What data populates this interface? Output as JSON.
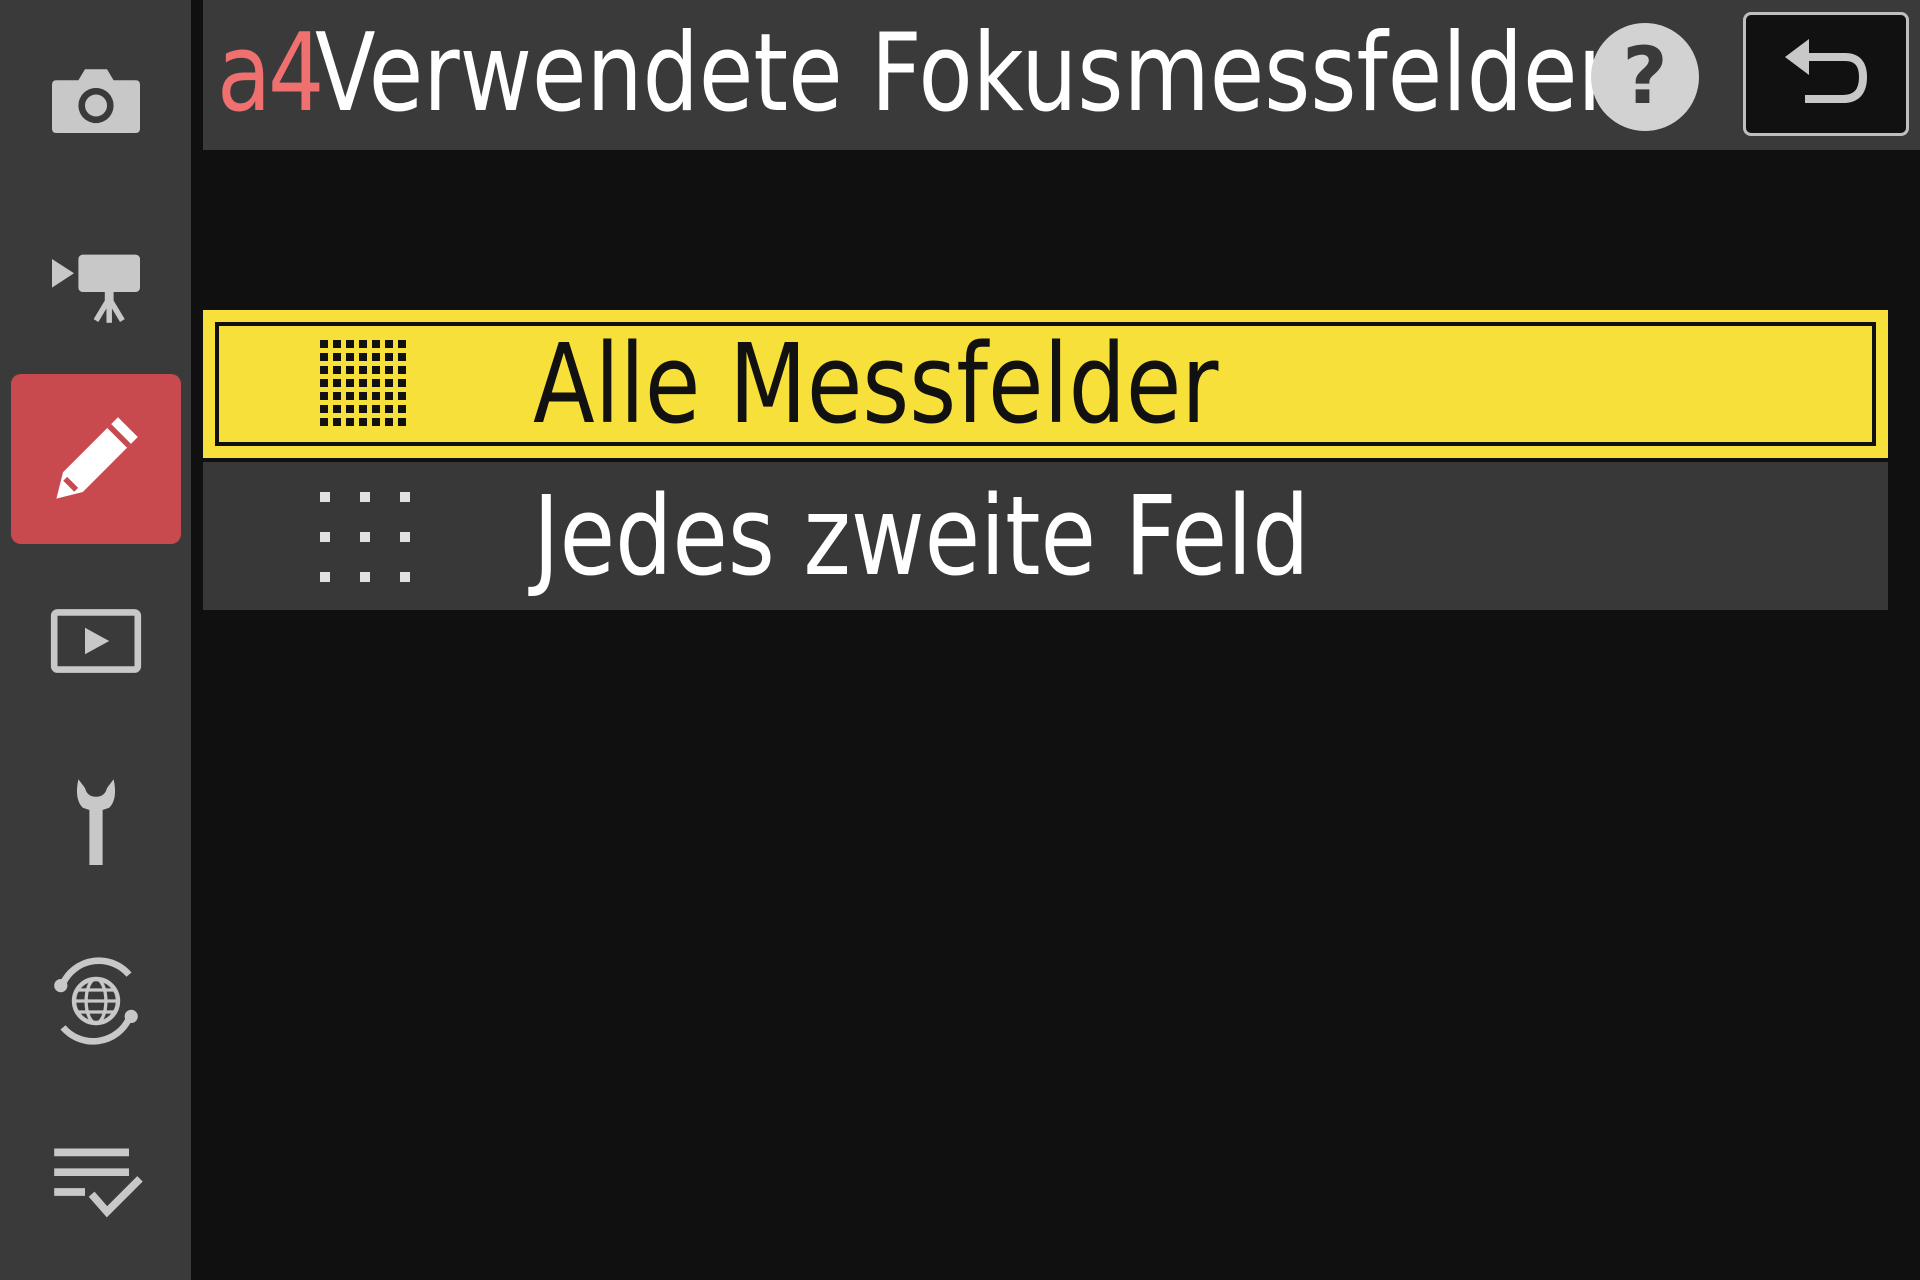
{
  "sidebar": {
    "tabs": [
      {
        "icon": "camera-icon",
        "name": "photo-shooting-menu",
        "active": false
      },
      {
        "icon": "movie-camera-icon",
        "name": "movie-recording-menu",
        "active": false
      },
      {
        "icon": "pencil-icon",
        "name": "custom-settings-menu",
        "active": true
      },
      {
        "icon": "playback-icon",
        "name": "playback-menu",
        "active": false
      },
      {
        "icon": "wrench-icon",
        "name": "setup-menu",
        "active": false
      },
      {
        "icon": "network-globe-icon",
        "name": "network-menu",
        "active": false
      },
      {
        "icon": "checklist-icon",
        "name": "my-menu",
        "active": false
      }
    ],
    "active_color": "#c84a4e"
  },
  "header": {
    "code": "a4",
    "title": "Verwendete Fokusmessfelder",
    "help_symbol": "?",
    "back_icon": "return-arrow-icon"
  },
  "options": [
    {
      "label": "Alle Messfelder",
      "icon": "dense-grid-icon",
      "selected": true
    },
    {
      "label": "Jedes zweite Feld",
      "icon": "sparse-grid-icon",
      "selected": false
    }
  ],
  "colors": {
    "selection": "#f7e03a",
    "code": "#f07070",
    "background": "#101010",
    "panel": "#3a3a3a"
  }
}
